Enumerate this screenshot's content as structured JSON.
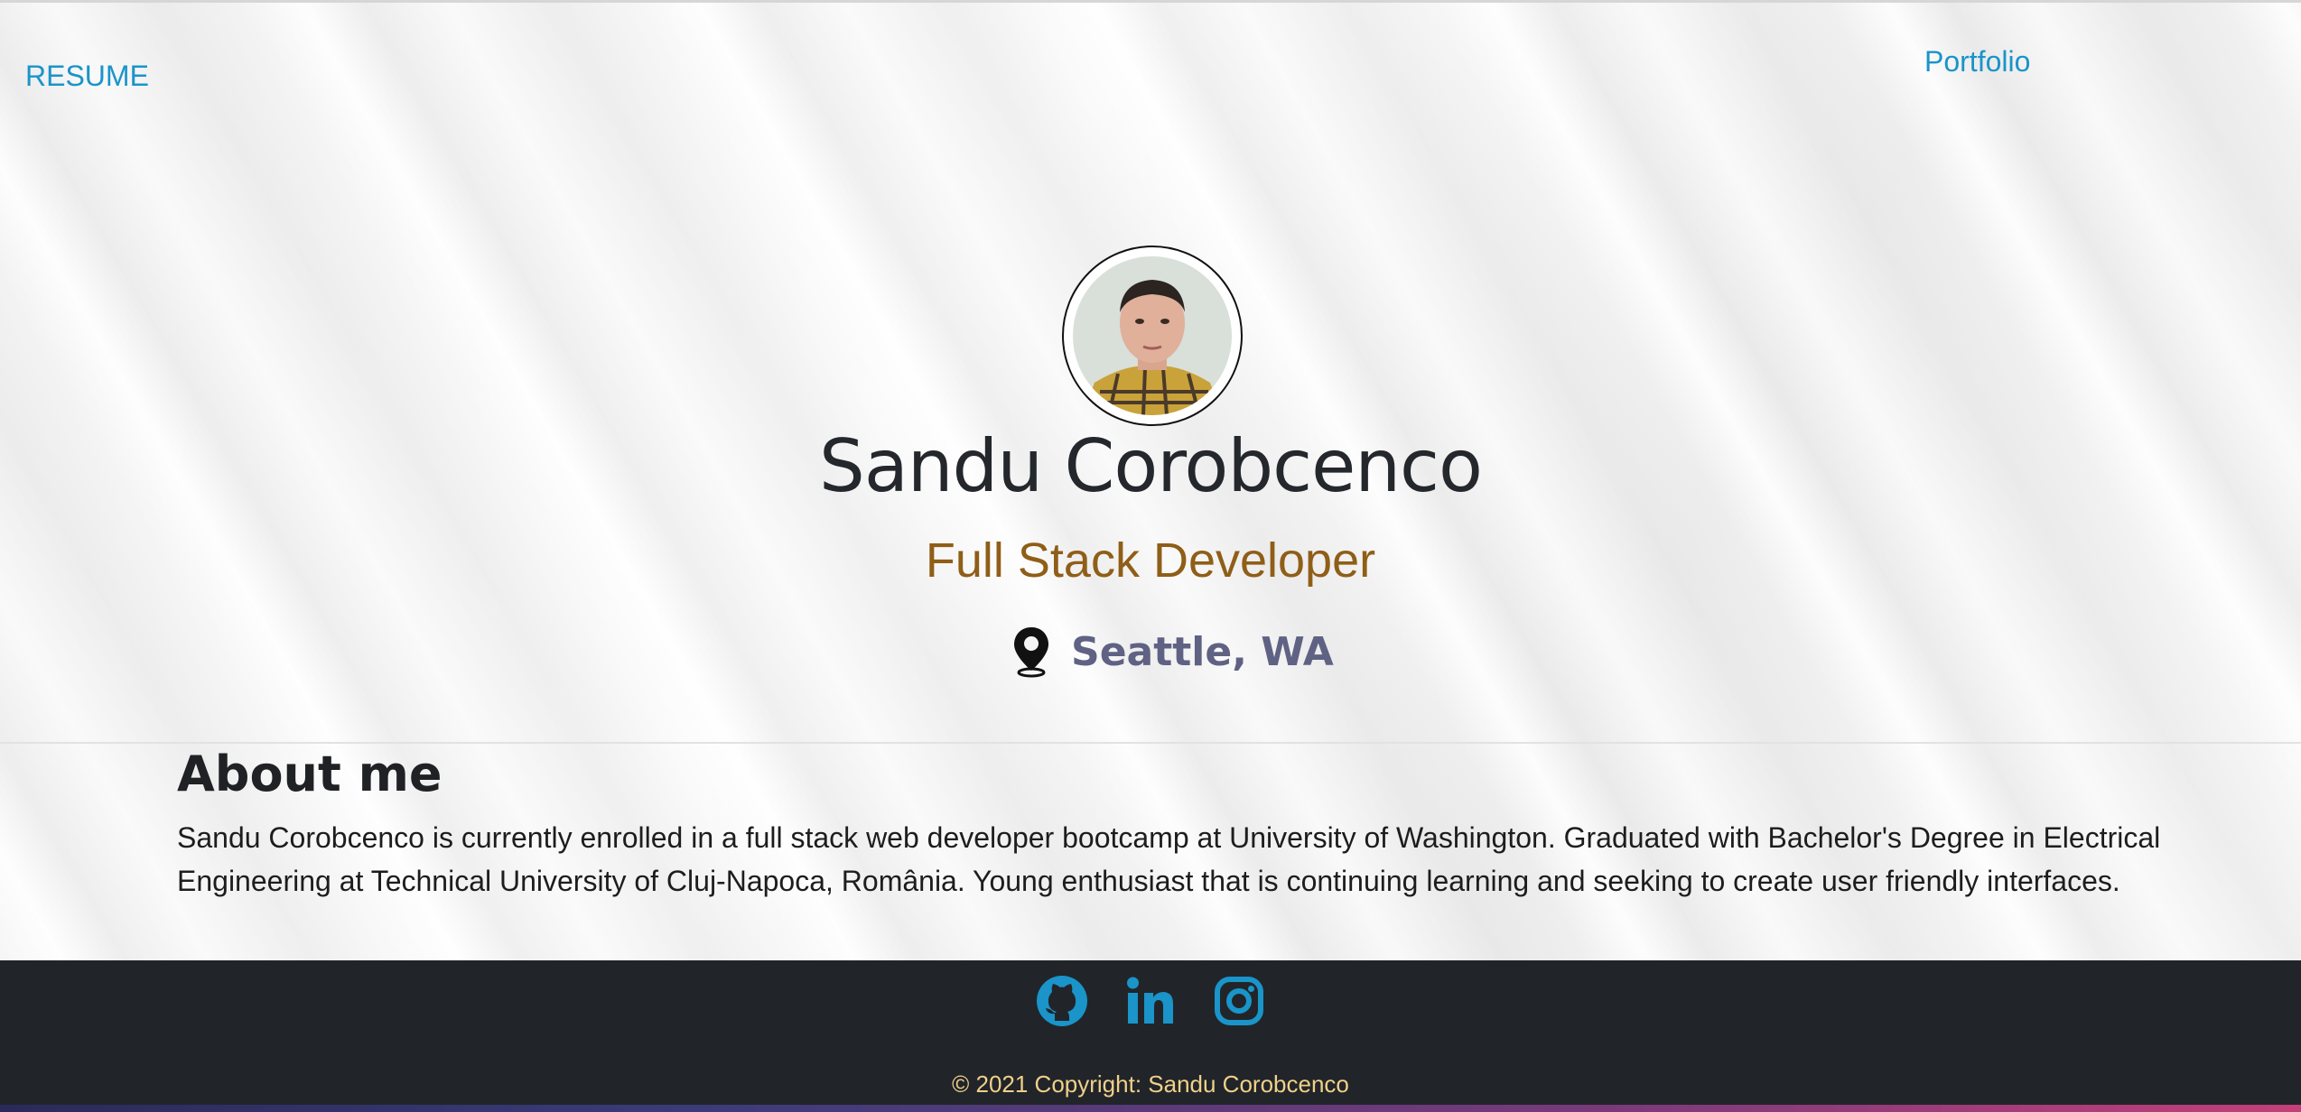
{
  "nav": {
    "resume_label": "RESUME",
    "portfolio_label": "Portfolio"
  },
  "hero": {
    "name": "Sandu Corobcenco",
    "role": "Full Stack Developer",
    "location": "Seattle, WA",
    "location_icon": "map-pin-icon"
  },
  "about": {
    "title": "About me",
    "text": "Sandu Corobcenco is currently enrolled in a full stack web developer bootcamp at University of Washington. Graduated with Bachelor's Degree in Electrical Engineering at Technical University of Cluj-Napoca, România. Young enthusiast that is continuing learning and seeking to create user friendly interfaces."
  },
  "footer": {
    "icons": [
      "github-icon",
      "linkedin-icon",
      "instagram-icon"
    ],
    "copyright": "© 2021 Copyright: Sandu Corobcenco"
  },
  "colors": {
    "link": "#1a94c9",
    "role": "#8f5e17",
    "location": "#5f6283",
    "footer_bg": "#212529",
    "copyright": "#f0d08a"
  }
}
